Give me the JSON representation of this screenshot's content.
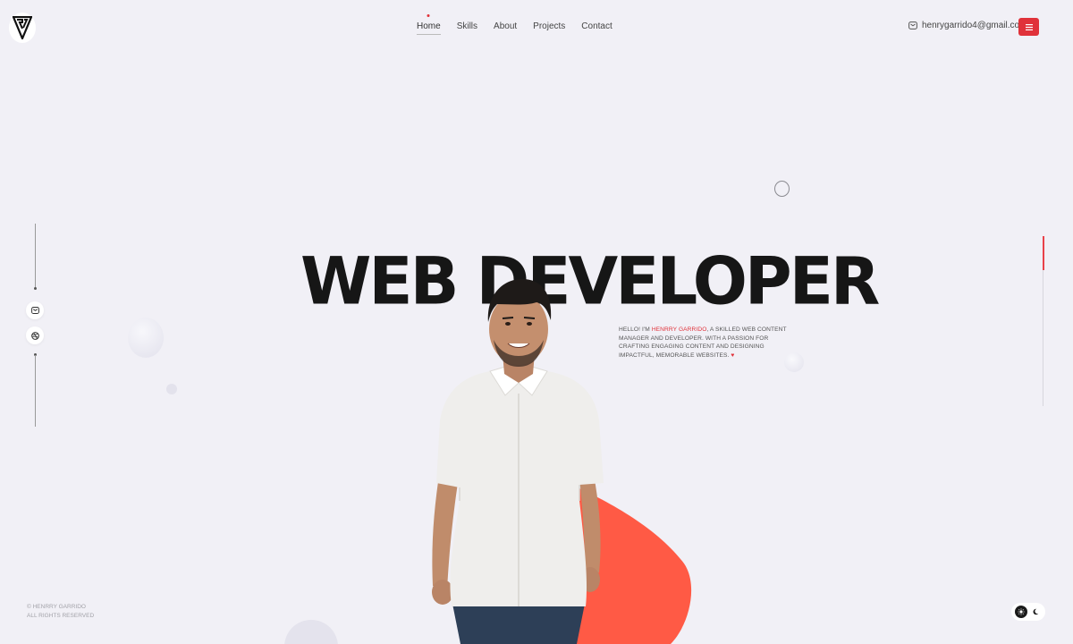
{
  "brand": {
    "logo_icon": "gv-monogram-logo"
  },
  "nav": {
    "items": [
      {
        "label": "Home",
        "active": true
      },
      {
        "label": "Skills",
        "active": false
      },
      {
        "label": "About",
        "active": false
      },
      {
        "label": "Projects",
        "active": false
      },
      {
        "label": "Contact",
        "active": false
      }
    ]
  },
  "header": {
    "email": "henrygarrido4@gmail.com",
    "email_icon": "mail-icon",
    "menu_icon": "hamburger-icon"
  },
  "social": {
    "items": [
      {
        "icon": "mail-icon"
      },
      {
        "icon": "dribbble-icon"
      }
    ]
  },
  "hero": {
    "title": "WEB DEVELOPER",
    "intro_prefix": "HELLO! I'M ",
    "intro_name": "HENRRY GARRIDO",
    "intro_rest": ", A SKILLED WEB CONTENT MANAGER AND DEVELOPER. WITH A PASSION FOR CRAFTING ENGAGING CONTENT AND DESIGNING IMPACTFUL, MEMORABLE WEBSITES.",
    "intro_heart": "♥"
  },
  "scroll_progress": 0.2,
  "footer": {
    "copyright": "© HENRRY GARRIDO",
    "rights": "ALL RIGHTS RESERVED"
  },
  "theme": {
    "current": "light",
    "light_icon": "sun-icon",
    "dark_icon": "moon-icon"
  },
  "colors": {
    "accent": "#e0323a",
    "blob": "#ff5a45",
    "background": "#f1f0f6"
  }
}
